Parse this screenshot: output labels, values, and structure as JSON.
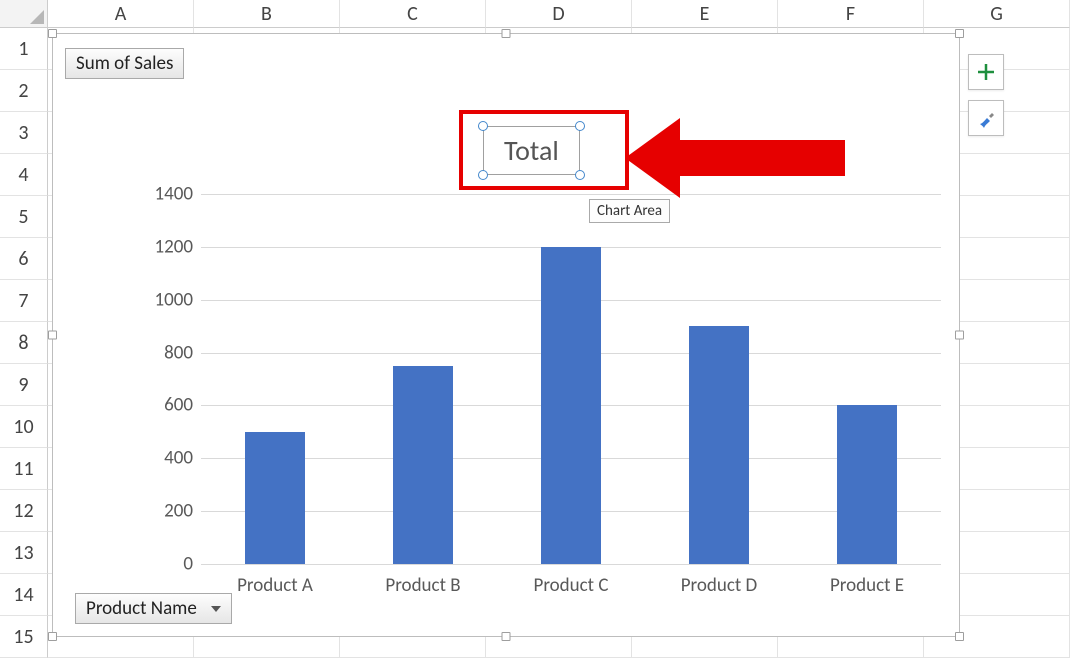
{
  "columns": [
    "A",
    "B",
    "C",
    "D",
    "E",
    "F",
    "G"
  ],
  "rows": [
    "1",
    "2",
    "3",
    "4",
    "5",
    "6",
    "7",
    "8",
    "9",
    "10",
    "11",
    "12",
    "13",
    "14",
    "15"
  ],
  "pivotFields": {
    "value": "Sum of Sales",
    "axis": "Product Name"
  },
  "chartTitle": "Total",
  "tooltip": "Chart Area",
  "chart_data": {
    "type": "bar",
    "title": "Total",
    "categories": [
      "Product A",
      "Product B",
      "Product C",
      "Product D",
      "Product E"
    ],
    "values": [
      500,
      750,
      1200,
      900,
      600
    ],
    "ylabel": "",
    "xlabel": "",
    "ylim": [
      0,
      1400
    ],
    "yticks": [
      0,
      200,
      400,
      600,
      800,
      1000,
      1200,
      1400
    ]
  },
  "sideButtons": {
    "add": "plus-icon",
    "style": "brush-icon"
  }
}
